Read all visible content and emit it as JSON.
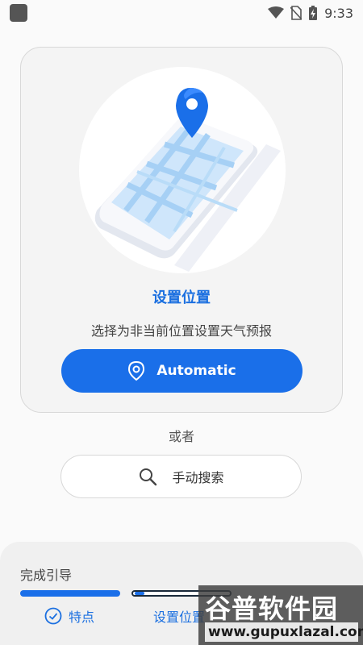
{
  "status_bar": {
    "time": "9:33",
    "icons": [
      "wifi-icon",
      "no-sim-icon",
      "battery-charging-icon"
    ]
  },
  "location_card": {
    "illustration": "map-phone-pin-illustration",
    "title": "设置位置",
    "subtitle": "选择为非当前位置设置天气预报",
    "automatic_button": {
      "label": "Automatic",
      "icon": "location-pin-icon"
    }
  },
  "separator": {
    "text": "或者"
  },
  "search_button": {
    "label": "手动搜索",
    "icon": "search-icon"
  },
  "guide": {
    "title": "完成引导",
    "steps": [
      {
        "label": "特点",
        "icon": "check-circle-icon",
        "progress": 1.0
      },
      {
        "label": "设置位置",
        "progress": 0.1
      }
    ]
  },
  "watermark": {
    "brand": "谷普软件园",
    "url": "www.gupuxlazal.com"
  },
  "colors": {
    "accent": "#1a6fe9",
    "card_bg": "#f4f4f4",
    "page_bg": "#fafafa"
  }
}
